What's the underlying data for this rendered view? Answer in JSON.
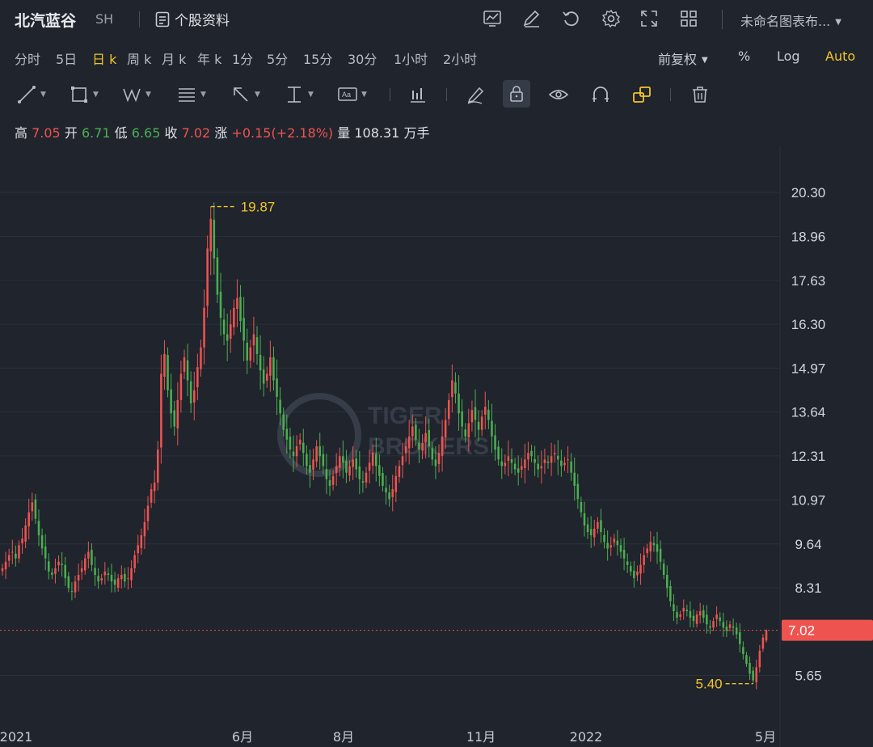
{
  "header": {
    "stock_name": "北汽蓝谷",
    "exchange": "SH",
    "profile_label": "个股资料",
    "layout_name": "未命名图表布..."
  },
  "toolbar_icons": [
    "chart-line-icon",
    "edit-icon",
    "reset-icon",
    "settings-icon",
    "fullscreen-icon",
    "grid-layout-icon"
  ],
  "periods": [
    "分时",
    "5日",
    "日 k",
    "周 k",
    "月 k",
    "年 k",
    "1分",
    "5分",
    "15分",
    "30分",
    "1小时",
    "2小时"
  ],
  "active_period": "日 k",
  "price_adjust": "前复权",
  "scale_options": {
    "percent": "%",
    "log": "Log",
    "auto": "Auto"
  },
  "drawing_tools": [
    "trend-line-icon",
    "rectangle-icon",
    "pattern-icon",
    "fibonacci-icon",
    "arrow-icon",
    "measure-icon",
    "text-icon",
    "indicator-icon",
    "pencil-icon",
    "lock-icon",
    "eye-icon",
    "magnet-icon",
    "layers-icon",
    "trash-icon"
  ],
  "quote": {
    "high_label": "高",
    "high": "7.05",
    "open_label": "开",
    "open": "6.71",
    "low_label": "低",
    "low": "6.65",
    "close_label": "收",
    "close": "7.02",
    "change_label": "涨",
    "change": "+0.15(+2.18%)",
    "volume_label": "量",
    "volume": "108.31 万手"
  },
  "colors": {
    "up": "#ef5350",
    "down": "#4caf50",
    "accent": "#f5c526",
    "background": "#1f242d"
  },
  "watermark": "TIGER BROKERS",
  "chart_data": {
    "type": "candlestick",
    "y_ticks": [
      "20.30",
      "18.96",
      "17.63",
      "16.30",
      "14.97",
      "13.64",
      "12.31",
      "10.97",
      "9.64",
      "8.31",
      "5.65"
    ],
    "x_ticks": [
      "2021",
      "6月",
      "8月",
      "11月",
      "2022",
      "5月"
    ],
    "current_price": "7.02",
    "high_marker": "19.87",
    "low_marker": "5.40",
    "close_series": [
      8.9,
      9.1,
      9.3,
      9.4,
      9.2,
      9.6,
      9.8,
      10.2,
      10.6,
      10.9,
      10.4,
      9.9,
      9.5,
      9.2,
      8.8,
      8.7,
      8.9,
      9.1,
      9.0,
      8.6,
      8.3,
      8.2,
      8.5,
      8.7,
      8.9,
      9.2,
      9.4,
      9.0,
      8.7,
      8.5,
      8.6,
      8.8,
      8.7,
      8.5,
      8.4,
      8.6,
      8.7,
      8.5,
      8.6,
      8.9,
      9.3,
      9.6,
      9.9,
      10.3,
      10.8,
      11.3,
      11.5,
      12.5,
      14.8,
      15.4,
      14.3,
      13.6,
      13.2,
      14.0,
      14.8,
      15.3,
      14.6,
      13.9,
      14.3,
      15.0,
      15.6,
      16.8,
      18.6,
      19.5,
      18.3,
      17.2,
      16.5,
      16.0,
      15.8,
      16.3,
      16.8,
      17.1,
      16.4,
      15.8,
      15.2,
      15.6,
      16.0,
      15.4,
      14.9,
      14.5,
      14.8,
      15.3,
      14.6,
      14.1,
      13.6,
      13.1,
      12.8,
      12.5,
      12.3,
      12.6,
      12.8,
      12.4,
      12.0,
      11.8,
      12.2,
      12.6,
      12.3,
      12.0,
      11.6,
      11.4,
      11.7,
      12.0,
      12.3,
      12.1,
      11.8,
      12.0,
      12.2,
      11.9,
      11.6,
      11.5,
      11.8,
      12.1,
      12.4,
      12.0,
      11.7,
      11.4,
      11.2,
      11.0,
      11.3,
      11.7,
      12.0,
      12.3,
      12.6,
      12.9,
      13.2,
      12.8,
      12.5,
      12.7,
      13.0,
      12.6,
      12.2,
      12.0,
      12.4,
      12.9,
      13.4,
      14.0,
      14.6,
      14.2,
      13.6,
      13.2,
      12.9,
      13.3,
      13.7,
      13.4,
      13.1,
      13.5,
      13.8,
      13.4,
      12.9,
      12.5,
      12.2,
      12.0,
      12.1,
      12.3,
      12.1,
      11.9,
      11.8,
      12.0,
      12.2,
      12.4,
      12.3,
      12.1,
      11.9,
      12.0,
      12.2,
      12.1,
      12.3,
      12.4,
      12.2,
      12.0,
      12.1,
      12.2,
      11.8,
      11.4,
      11.0,
      10.6,
      10.2,
      10.0,
      9.9,
      10.1,
      10.3,
      10.0,
      9.7,
      9.5,
      9.6,
      9.8,
      9.6,
      9.4,
      9.2,
      9.0,
      8.8,
      8.6,
      8.8,
      9.0,
      9.3,
      9.5,
      9.7,
      9.6,
      9.4,
      9.1,
      8.7,
      8.3,
      7.9,
      7.6,
      7.4,
      7.5,
      7.7,
      7.6,
      7.4,
      7.3,
      7.5,
      7.6,
      7.4,
      7.2,
      7.1,
      7.3,
      7.5,
      7.3,
      7.1,
      7.0,
      7.2,
      7.1,
      6.9,
      6.6,
      6.3,
      6.0,
      5.7,
      5.5,
      5.9,
      6.4,
      6.8,
      7.02
    ]
  }
}
